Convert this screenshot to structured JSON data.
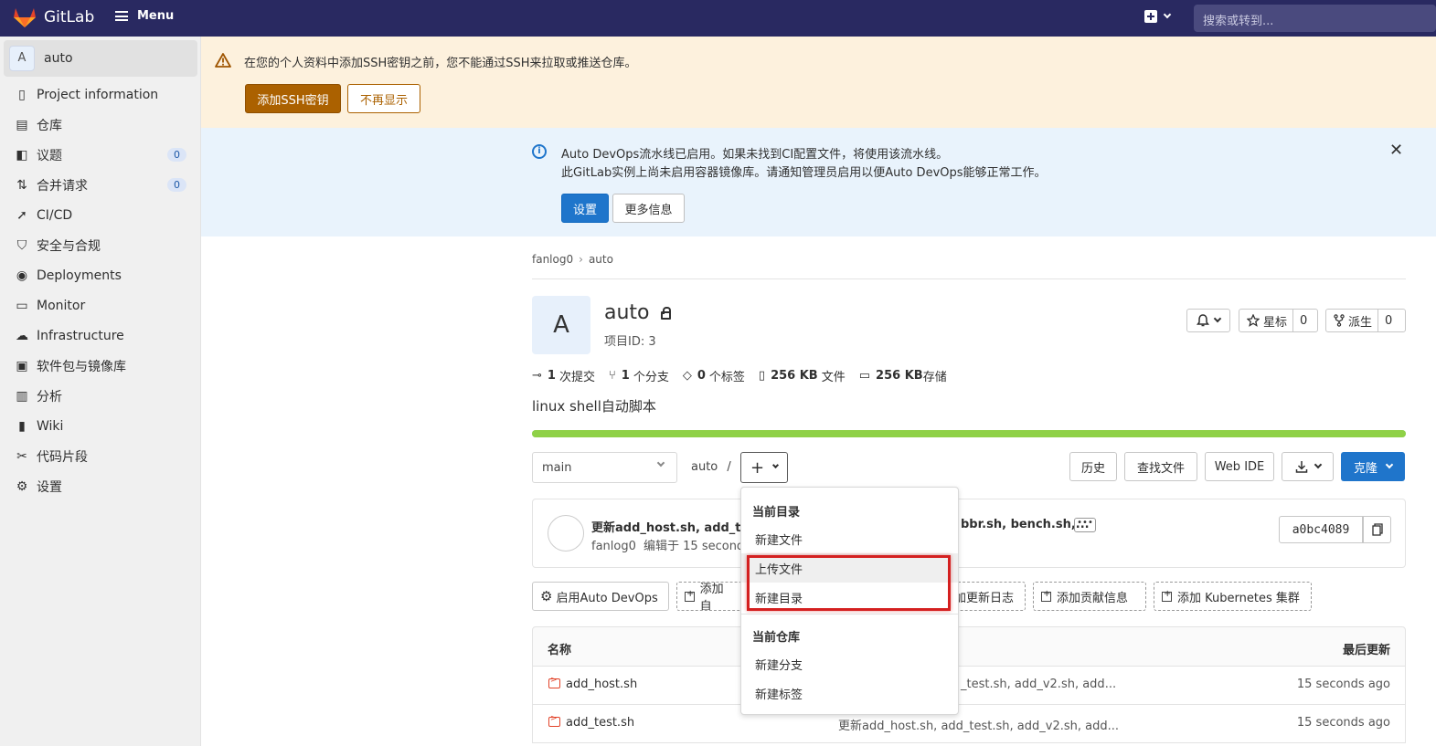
{
  "topnav": {
    "brand": "GitLab",
    "menu_label": "Menu",
    "search_placeholder": "搜索或转到..."
  },
  "sidebar": {
    "project_avatar": "A",
    "project_name": "auto",
    "items": [
      {
        "label": "Project information",
        "icon": "document-icon"
      },
      {
        "label": "仓库",
        "icon": "doc-icon"
      },
      {
        "label": "议题",
        "icon": "issues-icon",
        "badge": "0"
      },
      {
        "label": "合并请求",
        "icon": "merge-request-icon",
        "badge": "0"
      },
      {
        "label": "CI/CD",
        "icon": "rocket-icon"
      },
      {
        "label": "安全与合规",
        "icon": "shield-icon"
      },
      {
        "label": "Deployments",
        "icon": "deployments-icon"
      },
      {
        "label": "Monitor",
        "icon": "monitor-icon"
      },
      {
        "label": "Infrastructure",
        "icon": "cloud-icon"
      },
      {
        "label": "软件包与镜像库",
        "icon": "package-icon"
      },
      {
        "label": "分析",
        "icon": "chart-icon"
      },
      {
        "label": "Wiki",
        "icon": "book-icon"
      },
      {
        "label": "代码片段",
        "icon": "scissors-icon"
      },
      {
        "label": "设置",
        "icon": "gear-icon"
      }
    ]
  },
  "ssh_alert": {
    "text": "在您的个人资料中添加SSH密钥之前，您不能通过SSH来拉取或推送仓库。",
    "add_btn": "添加SSH密钥",
    "dismiss_btn": "不再显示"
  },
  "devops_alert": {
    "line1": "Auto DevOps流水线已启用。如果未找到CI配置文件，将使用该流水线。",
    "line2": "此GitLab实例上尚未启用容器镜像库。请通知管理员启用以便Auto DevOps能够正常工作。",
    "settings_btn": "设置",
    "more_btn": "更多信息"
  },
  "breadcrumb": {
    "group": "fanlog0",
    "project": "auto"
  },
  "project": {
    "avatar": "A",
    "name": "auto",
    "id_text": "项目ID: 3",
    "star_label": "星标",
    "star_count": "0",
    "fork_label": "派生",
    "fork_count": "0",
    "stats": [
      {
        "num": "1",
        "label": "次提交"
      },
      {
        "num": "1",
        "label": "个分支"
      },
      {
        "num": "0",
        "label": "个标签"
      },
      {
        "num": "256 KB",
        "label": "文件"
      },
      {
        "num": "256 KB",
        "label": "存储"
      }
    ],
    "description": "linux shell自动脚本",
    "language_fill": 1.0
  },
  "repo_toolbar": {
    "branch": "main",
    "path": "auto",
    "path_sep": "/",
    "history": "历史",
    "find_file": "查找文件",
    "web_ide": "Web IDE",
    "clone": "克隆"
  },
  "commit": {
    "title_start": "更新add_host.sh, add_test",
    "title_end": "bbr.sh, bench.sh,...",
    "author": "fanlog0",
    "edited": "编辑于 15 seconds",
    "sha": "a0bc4089"
  },
  "quick_actions": [
    "启用Auto DevOps",
    "添加自",
    "加更新日志",
    "添加贡献信息",
    "添加 Kubernetes 集群"
  ],
  "table": {
    "col_name": "名称",
    "col_updated": "最后更新",
    "rows": [
      {
        "name": "add_host.sh",
        "commit": "_test.sh, add_v2.sh, add...",
        "time": "15 seconds ago"
      },
      {
        "name": "add_test.sh",
        "commit": "更新add_host.sh, add_test.sh, add_v2.sh, add...",
        "time": "15 seconds ago"
      }
    ]
  },
  "dropdown": {
    "section1": "当前目录",
    "items1": [
      "新建文件",
      "上传文件",
      "新建目录"
    ],
    "section2": "当前仓库",
    "items2": [
      "新建分支",
      "新建标签"
    ]
  },
  "colors": {
    "nav": "#292961",
    "brand_orange": "#e24329",
    "primary": "#1f75cb",
    "highlight_box": "#d42020"
  }
}
